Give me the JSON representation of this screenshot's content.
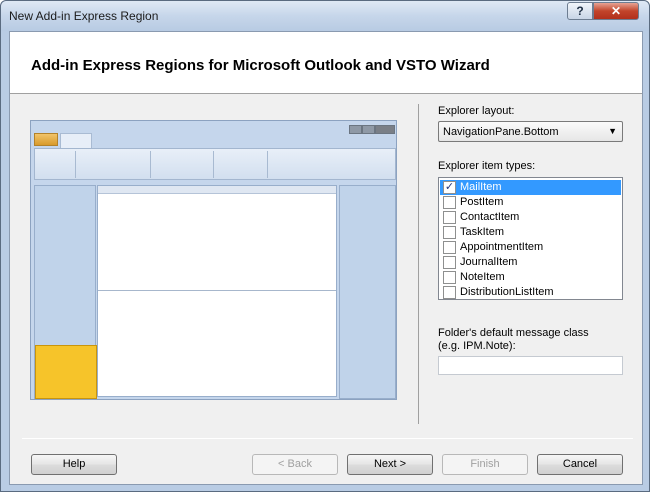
{
  "window": {
    "title": "New Add-in Express Region",
    "help_glyph": "?",
    "close_glyph": "✕"
  },
  "header": {
    "title": "Add-in Express Regions for Microsoft Outlook and VSTO Wizard"
  },
  "layout_field": {
    "label": "Explorer layout:",
    "value": "NavigationPane.Bottom"
  },
  "item_types": {
    "label": "Explorer item types:",
    "items": [
      {
        "label": "MailItem",
        "checked": true,
        "selected": true
      },
      {
        "label": "PostItem",
        "checked": false,
        "selected": false
      },
      {
        "label": "ContactItem",
        "checked": false,
        "selected": false
      },
      {
        "label": "TaskItem",
        "checked": false,
        "selected": false
      },
      {
        "label": "AppointmentItem",
        "checked": false,
        "selected": false
      },
      {
        "label": "JournalItem",
        "checked": false,
        "selected": false
      },
      {
        "label": "NoteItem",
        "checked": false,
        "selected": false
      },
      {
        "label": "DistributionListItem",
        "checked": false,
        "selected": false
      }
    ]
  },
  "message_class": {
    "label_line1": "Folder's default message class",
    "label_line2": "(e.g. IPM.Note):",
    "value": ""
  },
  "buttons": {
    "help": "Help",
    "back": "< Back",
    "next": "Next >",
    "finish": "Finish",
    "cancel": "Cancel"
  }
}
